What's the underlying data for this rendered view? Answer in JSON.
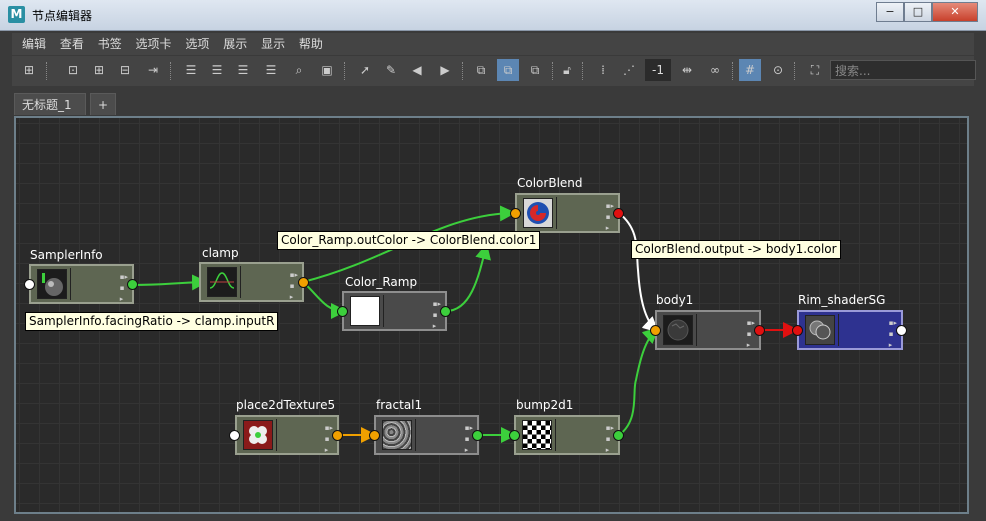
{
  "window": {
    "title": "节点编辑器",
    "app_icon": "M",
    "minimize": "−",
    "maximize": "□",
    "close": "✕"
  },
  "menu": [
    "编辑",
    "查看",
    "书签",
    "选项卡",
    "选项",
    "展示",
    "显示",
    "帮助"
  ],
  "toolbar": {
    "value_box": "-1",
    "search_placeholder": "搜索..."
  },
  "tabs": {
    "active": "无标题_1",
    "add": "+"
  },
  "nodes": {
    "samplerinfo": "SamplerInfo",
    "clamp": "clamp",
    "colorblend": "ColorBlend",
    "color_ramp": "Color_Ramp",
    "body1": "body1",
    "rim_shadersg": "Rim_shaderSG",
    "place2dtexture5": "place2dTexture5",
    "fractal1": "fractal1",
    "bump2d1": "bump2d1"
  },
  "tooltips": {
    "ramp_to_blend": "Color_Ramp.outColor -> ColorBlend.color1",
    "blend_to_body": "ColorBlend.output -> body1.color",
    "sampler_to_clamp": "SamplerInfo.facingRatio -> clamp.inputR"
  },
  "colors": {
    "port_green": "#3ccf3c",
    "port_orange": "#f0a000",
    "port_red": "#e01010",
    "port_white": "#ffffff",
    "node_utility": "#5e6652",
    "node_texture": "#4a4a4a",
    "node_shading_group": "#2e3290",
    "tooltip_bg": "#ffffe1"
  }
}
